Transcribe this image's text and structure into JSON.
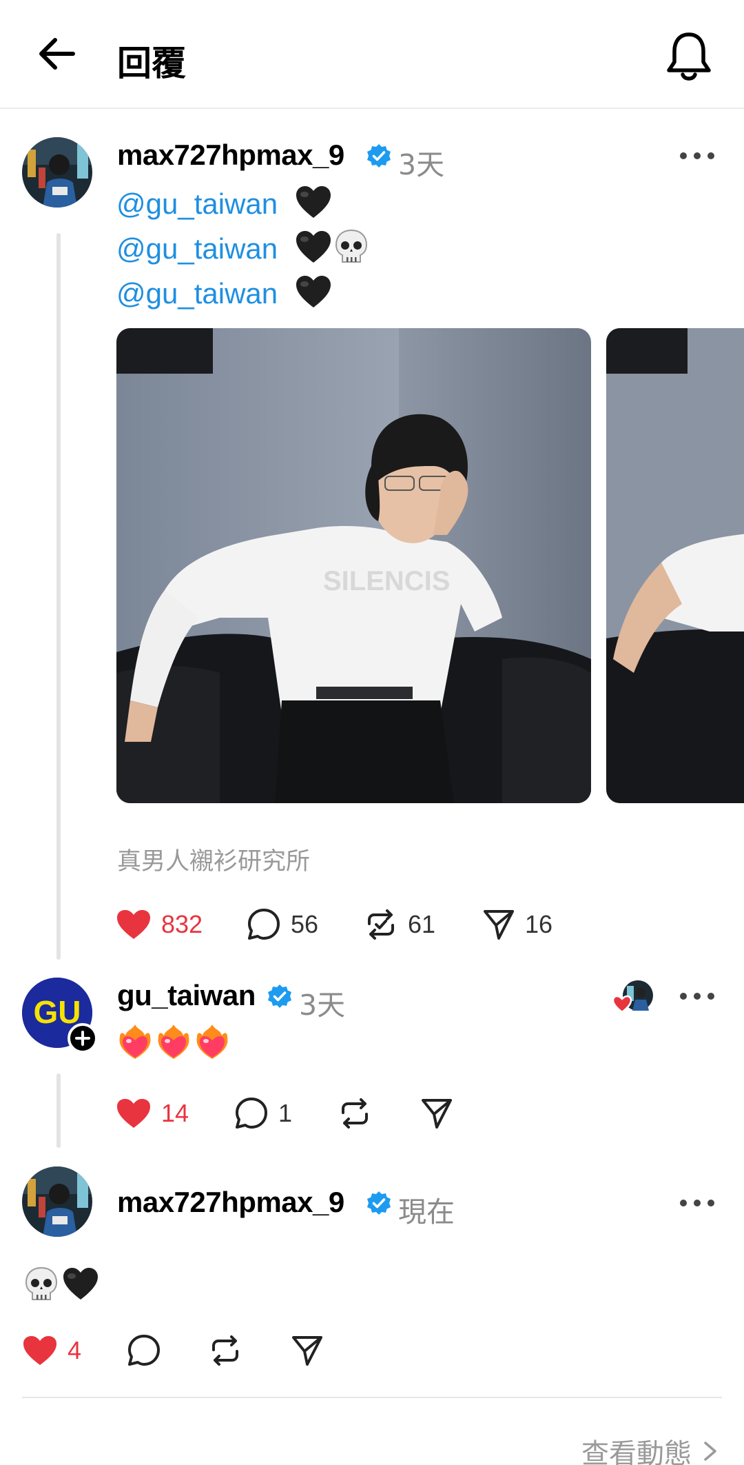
{
  "header": {
    "title": "回覆"
  },
  "post1": {
    "username": "max727hpmax_9",
    "time": "3天",
    "mentions": [
      "@gu_taiwan",
      "@gu_taiwan",
      "@gu_taiwan"
    ],
    "caption": "真男人襯衫研究所",
    "likes": "832",
    "comments": "56",
    "reposts": "61",
    "shares": "16"
  },
  "reply1": {
    "username": "gu_taiwan",
    "time": "3天",
    "likes": "14",
    "comments": "1"
  },
  "reply2": {
    "username": "max727hpmax_9",
    "time": "現在",
    "likes": "4"
  },
  "footer": {
    "view_activity": "查看動態"
  },
  "icons": [
    "back-arrow-icon",
    "bell-icon",
    "verified-icon",
    "more-icon",
    "heart-icon",
    "comment-icon",
    "repost-icon",
    "share-icon",
    "chevron-right-icon"
  ],
  "colors": {
    "like": "#e8343f",
    "mention": "#1e8fe1",
    "verified": "#1d9bf0",
    "muted": "#8b8b8b"
  }
}
